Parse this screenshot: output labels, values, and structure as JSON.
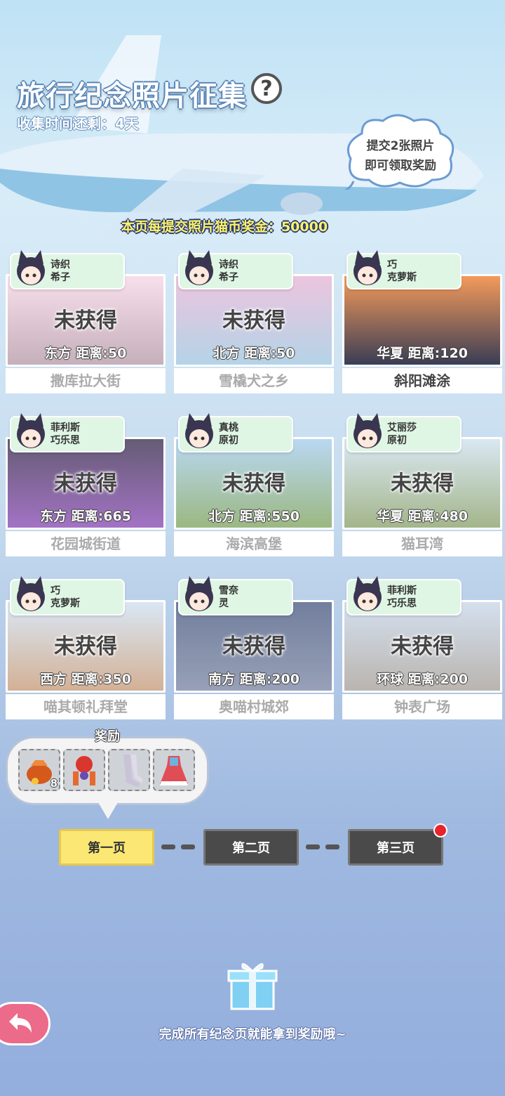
{
  "header": {
    "title": "旅行纪念照片征集",
    "help_label": "?",
    "timer": "收集时间还剩：4天",
    "bubble_line1": "提交2张照片",
    "bubble_line2": "即可领取奖励",
    "bonus": "本页每提交照片猫币奖金：50000"
  },
  "cards": [
    {
      "names1": "诗织",
      "names2": "希子",
      "status": "未获得",
      "distance": "东方  距离:50",
      "location": "撒库拉大街",
      "collected": false,
      "photo_colors": [
        "#f6d6e6",
        "#b59aa8"
      ]
    },
    {
      "names1": "诗织",
      "names2": "希子",
      "status": "未获得",
      "distance": "北方  距离:50",
      "location": "雪橇犬之乡",
      "collected": false,
      "photo_colors": [
        "#e7b5d6",
        "#9fc7e0"
      ]
    },
    {
      "names1": "巧",
      "names2": "克萝斯",
      "status": "",
      "distance": "华夏  距离:120",
      "location": "斜阳滩涂",
      "collected": true,
      "photo_colors": [
        "#f49a5a",
        "#3a3d55"
      ]
    },
    {
      "names1": "菲利斯",
      "names2": "巧乐思",
      "status": "未获得",
      "distance": "东方  距离:665",
      "location": "花园城街道",
      "collected": false,
      "photo_colors": [
        "#3a2f4e",
        "#8a4bb5"
      ]
    },
    {
      "names1": "真桃",
      "names2": "原初",
      "status": "未获得",
      "distance": "北方  距离:550",
      "location": "海滨高堡",
      "collected": false,
      "photo_colors": [
        "#a6cdef",
        "#7fa45e"
      ]
    },
    {
      "names1": "艾丽莎",
      "names2": "原初",
      "status": "未获得",
      "distance": "华夏  距离:480",
      "location": "猫耳湾",
      "collected": false,
      "photo_colors": [
        "#cfe1ef",
        "#8aa16a"
      ]
    },
    {
      "names1": "巧",
      "names2": "克萝斯",
      "status": "未获得",
      "distance": "西方  距离:350",
      "location": "喵其顿礼拜堂",
      "collected": false,
      "photo_colors": [
        "#cfe0f2",
        "#c79b78"
      ]
    },
    {
      "names1": "雪奈",
      "names2": "灵",
      "status": "未获得",
      "distance": "南方  距离:200",
      "location": "奥喵村城郊",
      "collected": false,
      "photo_colors": [
        "#4a5b82",
        "#7b86a4"
      ]
    },
    {
      "names1": "菲利斯",
      "names2": "巧乐思",
      "status": "未获得",
      "distance": "环球  距离:200",
      "location": "钟表广场",
      "collected": false,
      "photo_colors": [
        "#c8d7ea",
        "#a7a099"
      ]
    }
  ],
  "rewards": {
    "label": "奖励",
    "items": [
      {
        "icon": "coin-pouch-icon",
        "count": "8",
        "color": "#d45a1c"
      },
      {
        "icon": "lantern-ornament-icon",
        "count": "",
        "color": "#d9362e"
      },
      {
        "icon": "stockings-icon",
        "count": "",
        "color": "#c9c2d9"
      },
      {
        "icon": "costume-dress-icon",
        "count": "",
        "color": "#e14d55"
      }
    ]
  },
  "pages": {
    "page1": "第一页",
    "page2": "第二页",
    "page3": "第三页",
    "active": "第一页"
  },
  "footer": {
    "text": "完成所有纪念页就能拿到奖励哦~"
  }
}
